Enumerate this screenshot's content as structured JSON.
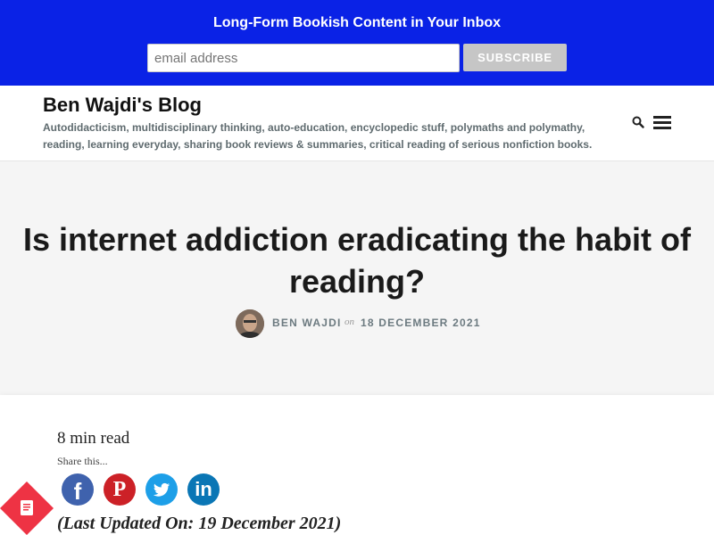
{
  "newsletter": {
    "title": "Long-Form Bookish Content in Your Inbox",
    "email_placeholder": "email address",
    "subscribe_label": "SUBSCRIBE",
    "bg_color": "#0a22e6"
  },
  "header": {
    "site_title": "Ben Wajdi's Blog",
    "description": "Autodidacticism, multidisciplinary thinking, auto-education, encyclopedic stuff, polymaths and polymathy, reading, learning everyday, sharing book reviews & summaries, critical reading of serious nonfiction books.",
    "icons": [
      "search-icon",
      "menu-icon"
    ]
  },
  "post": {
    "title": "Is internet addiction eradicating the habit of reading?",
    "author": "BEN WAJDI",
    "on_word": "on",
    "date": "18 DECEMBER 2021",
    "read_time": "8 min read",
    "share_label": "Share this...",
    "share_icons": [
      "facebook-icon",
      "pinterest-icon",
      "twitter-icon",
      "linkedin-icon"
    ],
    "last_updated": "(Last Updated On: 19 December 2021)"
  },
  "floating_badge": {
    "icon": "book-icon",
    "color": "#ee3344"
  }
}
